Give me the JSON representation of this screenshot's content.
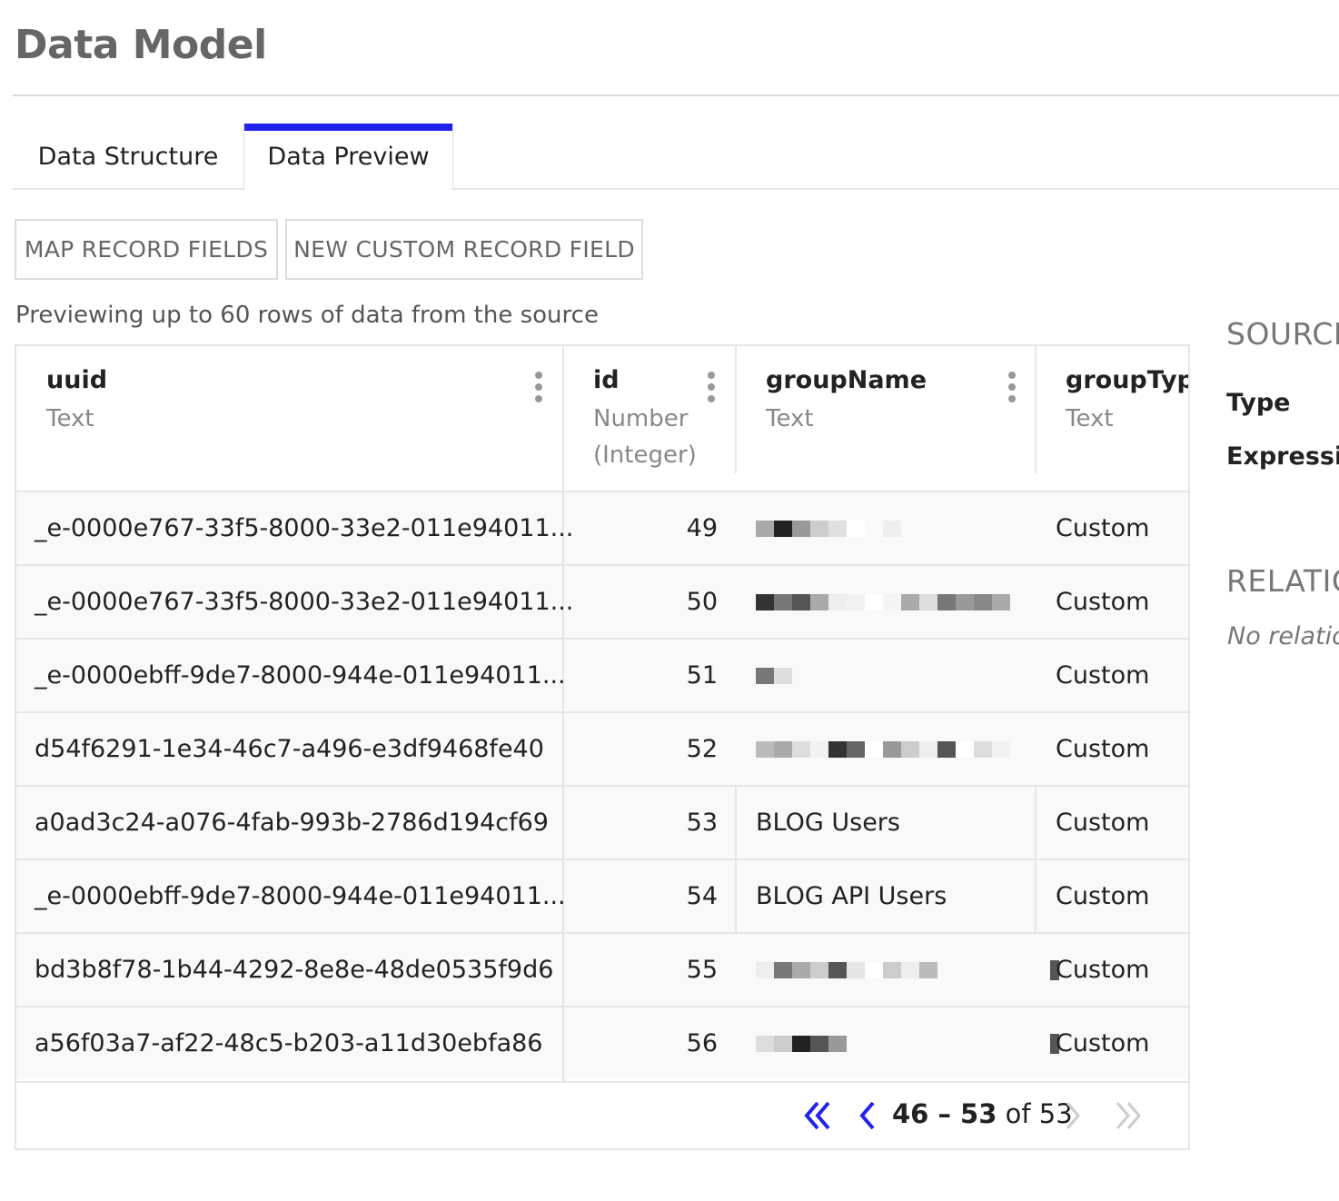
{
  "page": {
    "title": "Data Model"
  },
  "tabs": [
    {
      "label": "Data Structure",
      "active": false
    },
    {
      "label": "Data Preview",
      "active": true
    }
  ],
  "accent_color": "#2222ee",
  "toolbar": {
    "map_label": "MAP RECORD FIELDS",
    "new_label": "NEW CUSTOM RECORD FIELD"
  },
  "preview_note": "Previewing up to 60 rows of data from the source",
  "columns": [
    {
      "name": "uuid",
      "type": "Text"
    },
    {
      "name": "id",
      "type_line1": "Number",
      "type_line2": "(Integer)"
    },
    {
      "name": "groupName",
      "type": "Text"
    },
    {
      "name": "groupType",
      "type": "Text"
    }
  ],
  "rows": [
    {
      "uuid": "_e-0000e767-33f5-8000-33e2-011e94011...",
      "id": "49",
      "groupName": "",
      "groupType": "Custom"
    },
    {
      "uuid": "_e-0000e767-33f5-8000-33e2-011e94011...",
      "id": "50",
      "groupName": "",
      "groupType": "Custom"
    },
    {
      "uuid": "_e-0000ebff-9de7-8000-944e-011e94011...",
      "id": "51",
      "groupName": "",
      "groupType": "Custom"
    },
    {
      "uuid": "d54f6291-1e34-46c7-a496-e3df9468fe40",
      "id": "52",
      "groupName": "",
      "groupType": "Custom"
    },
    {
      "uuid": "a0ad3c24-a076-4fab-993b-2786d194cf69",
      "id": "53",
      "groupName": "BLOG Users",
      "groupType": "Custom"
    },
    {
      "uuid": "_e-0000ebff-9de7-8000-944e-011e94011...",
      "id": "54",
      "groupName": "BLOG API Users",
      "groupType": "Custom"
    },
    {
      "uuid": "bd3b8f78-1b44-4292-8e8e-48de0535f9d6",
      "id": "55",
      "groupName": "",
      "groupType": "Custom"
    },
    {
      "uuid": "a56f03a7-af22-48c5-b203-a11d30ebfa86",
      "id": "56",
      "groupName": "",
      "groupType": "Custom"
    }
  ],
  "pager": {
    "range": "46 – 53",
    "of_word": "of",
    "total": "53",
    "first_icon": "double-chevron-left-icon",
    "prev_icon": "chevron-left-icon",
    "next_icon": "chevron-right-icon",
    "last_icon": "double-chevron-right-icon"
  },
  "side_panel": {
    "source_heading": "SOURCE",
    "type_label": "Type",
    "expression_label": "Expression",
    "relationships_heading": "RELATIONSHIPS",
    "no_relationships": "No relationships"
  }
}
